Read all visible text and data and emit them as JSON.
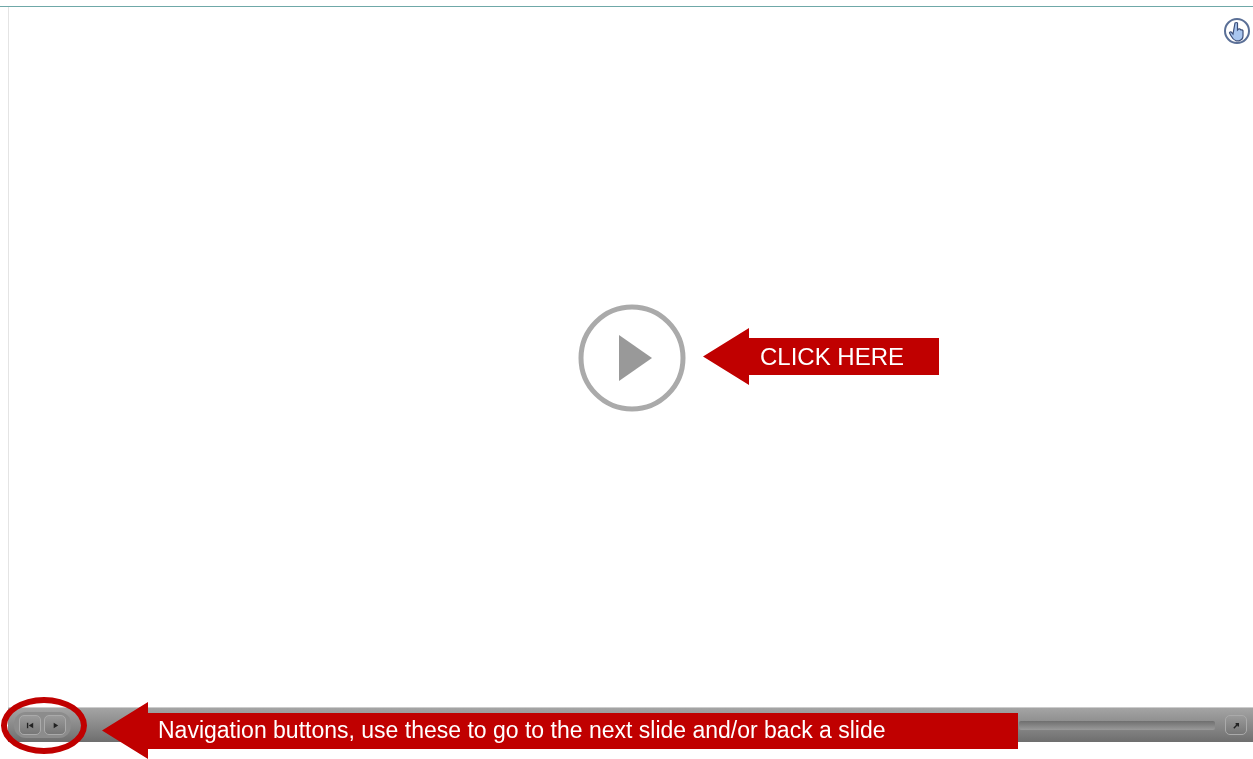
{
  "stage_callout": {
    "text": "CLICK HERE"
  },
  "toolbar_callout": {
    "text": "Navigation buttons, use these to go to the next slide and/or back a slide"
  }
}
